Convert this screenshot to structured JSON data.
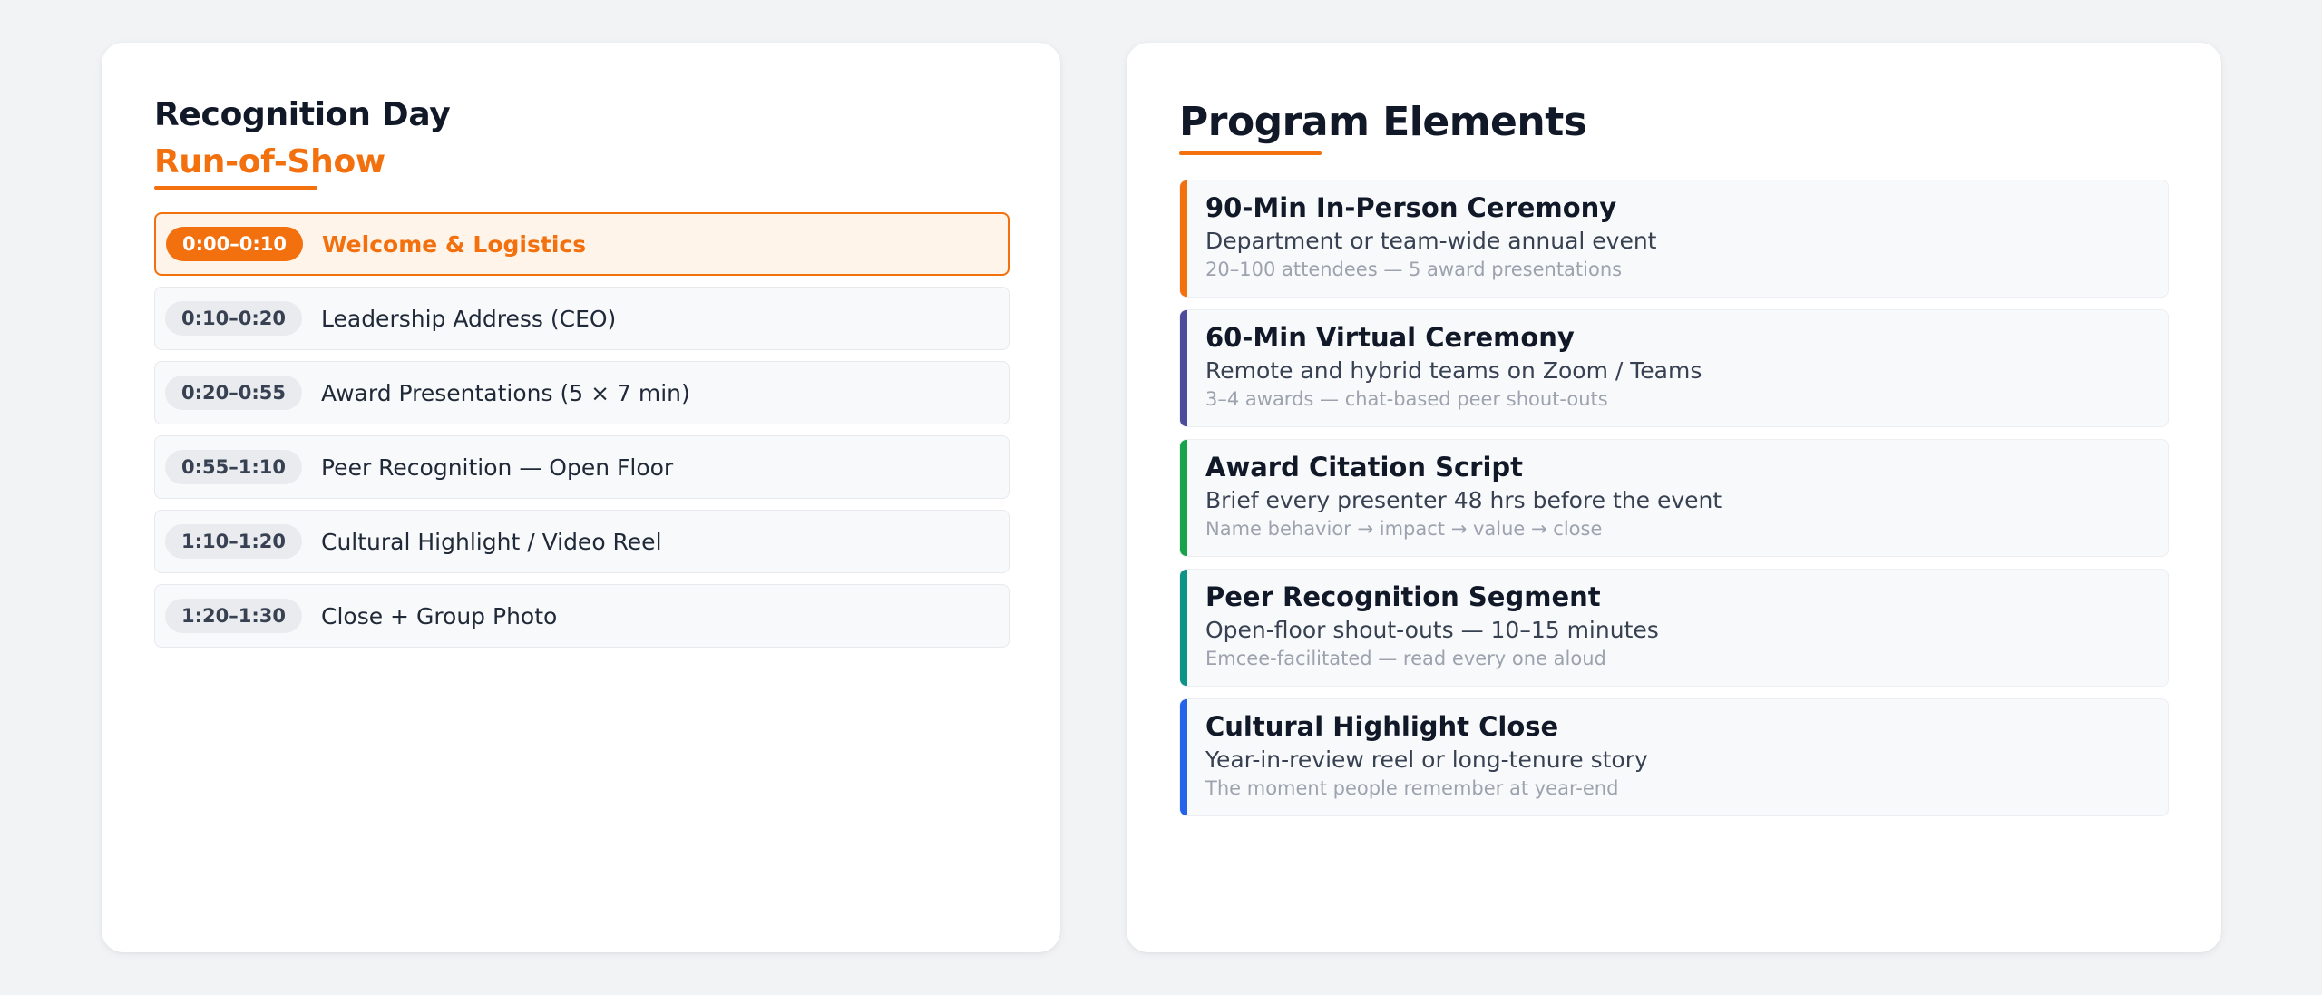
{
  "run_of_show": {
    "title": "Recognition Day",
    "subtitle": "Run-of-Show",
    "items": [
      {
        "time": "0:00–0:10",
        "label": "Welcome & Logistics",
        "active": true
      },
      {
        "time": "0:10–0:20",
        "label": "Leadership Address (CEO)",
        "active": false
      },
      {
        "time": "0:20–0:55",
        "label": "Award Presentations (5 × 7 min)",
        "active": false
      },
      {
        "time": "0:55–1:10",
        "label": "Peer Recognition — Open Floor",
        "active": false
      },
      {
        "time": "1:10–1:20",
        "label": "Cultural Highlight / Video Reel",
        "active": false
      },
      {
        "time": "1:20–1:30",
        "label": "Close + Group Photo",
        "active": false
      }
    ]
  },
  "program_elements": {
    "title": "Program Elements",
    "items": [
      {
        "title": "90-Min In-Person Ceremony",
        "description": "Department or team-wide annual event",
        "note": "20–100 attendees — 5 award presentations",
        "accent": "#f2700d"
      },
      {
        "title": "60-Min Virtual Ceremony",
        "description": "Remote and hybrid teams on Zoom / Teams",
        "note": "3–4 awards — chat-based peer shout-outs",
        "accent": "#4c4c9a"
      },
      {
        "title": "Award Citation Script",
        "description": "Brief every presenter 48 hrs before the event",
        "note": "Name behavior → impact → value → close",
        "accent": "#16a34a"
      },
      {
        "title": "Peer Recognition Segment",
        "description": "Open-floor shout-outs — 10–15 minutes",
        "note": "Emcee-facilitated — read every one aloud",
        "accent": "#0d9488"
      },
      {
        "title": "Cultural Highlight Close",
        "description": "Year-in-review reel or long-tenure story",
        "note": "The moment people remember at year-end",
        "accent": "#2563eb"
      }
    ]
  },
  "colors": {
    "accent": "#f2700d",
    "active_row_background": "#fff4ea",
    "page_background": "#f2f3f5",
    "card_background": "#ffffff"
  }
}
